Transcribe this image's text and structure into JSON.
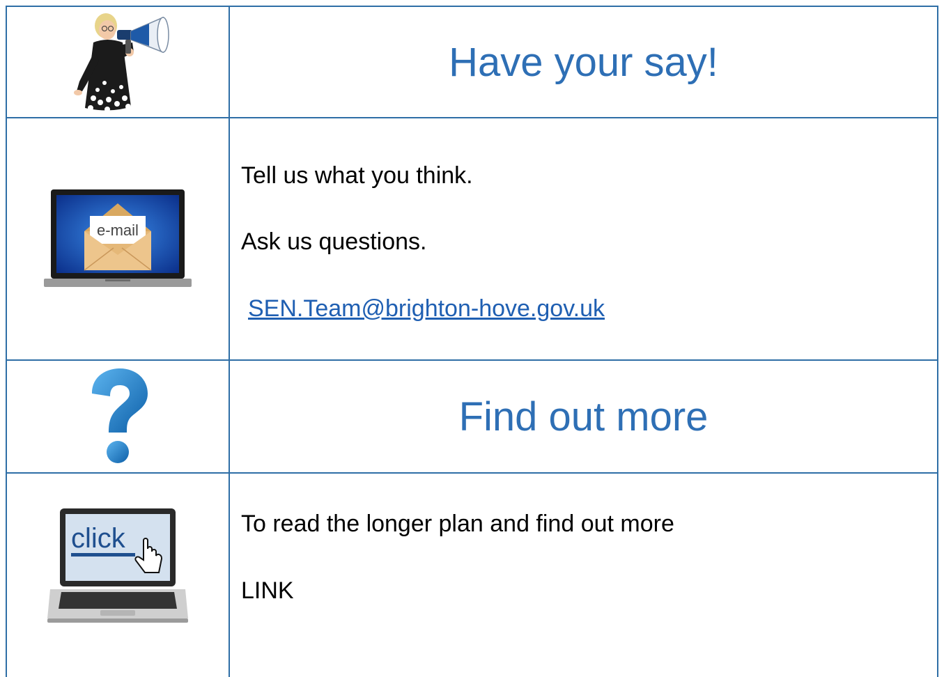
{
  "section1": {
    "heading": "Have your say!",
    "icon": "megaphone-person-icon"
  },
  "section2": {
    "icon": "email-laptop-icon",
    "icon_text": "e-mail",
    "line1": "Tell us what you think.",
    "line2": "Ask us questions.",
    "email": "SEN.Team@brighton-hove.gov.uk"
  },
  "section3": {
    "heading": "Find out more",
    "icon": "question-mark-icon"
  },
  "section4": {
    "icon": "click-laptop-icon",
    "icon_text": "click",
    "line1": "To read the longer plan and find out more",
    "line2": "LINK"
  },
  "colors": {
    "border": "#2e6ea6",
    "heading": "#2e6fb5",
    "link": "#1f5fb2"
  }
}
